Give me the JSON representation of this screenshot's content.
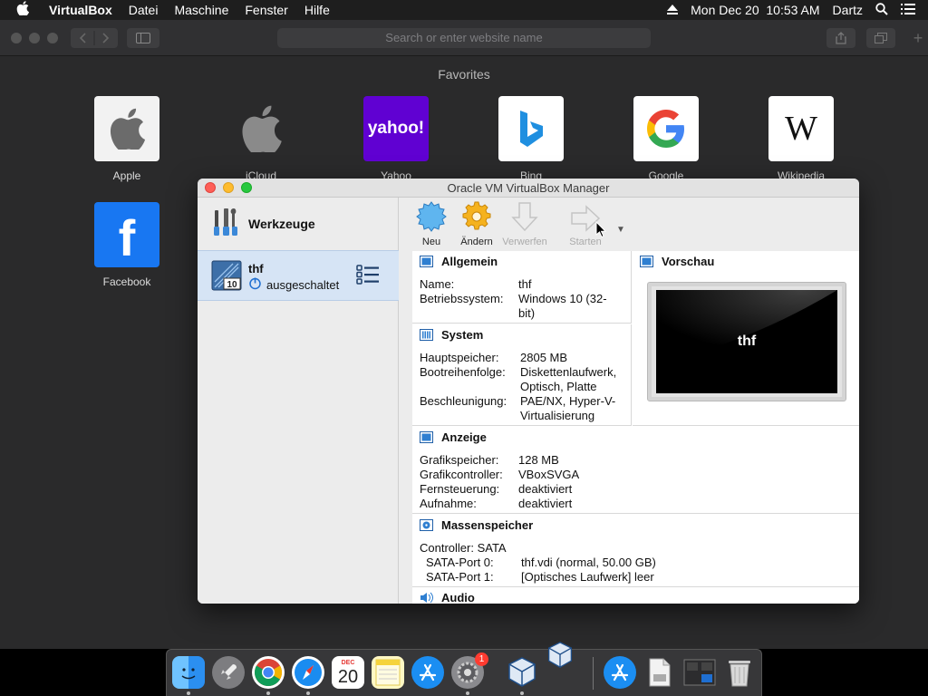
{
  "menubar": {
    "app": "VirtualBox",
    "items": [
      "Datei",
      "Maschine",
      "Fenster",
      "Hilfe"
    ],
    "datetime": "Mon Dec 20  10:53 AM",
    "user": "Dartz"
  },
  "safari": {
    "address_placeholder": "Search or enter website name",
    "favorites_title": "Favorites",
    "favorites": [
      {
        "label": "Apple"
      },
      {
        "label": "iCloud"
      },
      {
        "label": "Yahoo",
        "tile_text": "yahoo!"
      },
      {
        "label": "Bing"
      },
      {
        "label": "Google",
        "tile_text": "G"
      },
      {
        "label": "Wikipedia",
        "tile_text": "W"
      },
      {
        "label": "Facebook",
        "tile_text": "f"
      }
    ]
  },
  "vbox": {
    "title": "Oracle VM VirtualBox Manager",
    "sidebar": {
      "tools_label": "Werkzeuge",
      "vm_name": "thf",
      "vm_state": "ausgeschaltet",
      "vm_badge": "10"
    },
    "toolbar": {
      "new": "Neu",
      "change": "Ändern",
      "discard": "Verwerfen",
      "start": "Starten"
    },
    "general": {
      "title": "Allgemein",
      "name_key": "Name:",
      "name_val": "thf",
      "os_key": "Betriebssystem:",
      "os_val_1": "Windows 10 (32-",
      "os_val_2": "bit)"
    },
    "system": {
      "title": "System",
      "mem_key": "Hauptspeicher:",
      "mem_val": "2805 MB",
      "boot_key": "Bootreihenfolge:",
      "boot_val_1": "Diskettenlaufwerk,",
      "boot_val_2": "Optisch, Platte",
      "accel_key": "Beschleunigung:",
      "accel_val_1": "PAE/NX, Hyper-V-",
      "accel_val_2": "Virtualisierung"
    },
    "preview": {
      "title": "Vorschau",
      "screen_text": "thf"
    },
    "display": {
      "title": "Anzeige",
      "vram_key": "Grafikspeicher:",
      "vram_val": "128 MB",
      "ctrl_key": "Grafikcontroller:",
      "ctrl_val": "VBoxSVGA",
      "remote_key": "Fernsteuerung:",
      "remote_val": "deaktiviert",
      "rec_key": "Aufnahme:",
      "rec_val": "deaktiviert"
    },
    "storage": {
      "title": "Massenspeicher",
      "controller": "Controller: SATA",
      "port0_key": "SATA-Port 0:",
      "port0_val": "thf.vdi (normal, 50.00 GB)",
      "port1_key": "SATA-Port 1:",
      "port1_val": "[Optisches Laufwerk] leer"
    },
    "audio": {
      "title": "Audio"
    }
  },
  "dock": {
    "calendar_month": "DEC",
    "calendar_day": "20",
    "settings_badge": "1"
  },
  "colors": {
    "selection": "#d6e4f5",
    "accent_blue": "#1f6fd1",
    "yahoo_purple": "#6001d2",
    "facebook_blue": "#1877f2"
  }
}
